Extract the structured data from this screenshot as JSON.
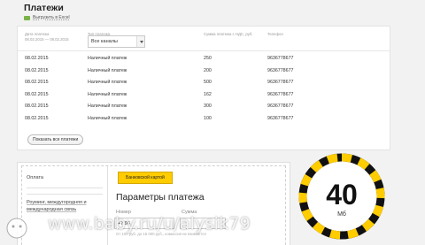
{
  "page": {
    "title": "Платежи",
    "export_label": "Выгрузить в Excel"
  },
  "filters": {
    "date_header": "Дата платежа",
    "date_range": "08.02.2015 — 08.02.2015",
    "type_header": "Тип платежа",
    "channel_selected": "Все каналы",
    "sum_header": "Сумма платежа с НДС, руб.",
    "phone_header": "Телефон"
  },
  "payments": [
    {
      "date": "08.02.2015",
      "type": "Наличный платеж",
      "sum": "250",
      "phone": "9636778677"
    },
    {
      "date": "08.02.2015",
      "type": "Наличный платеж",
      "sum": "200",
      "phone": "9636778677"
    },
    {
      "date": "08.02.2015",
      "type": "Наличный платеж",
      "sum": "500",
      "phone": "9636778677"
    },
    {
      "date": "08.02.2015",
      "type": "Наличный платеж",
      "sum": "162",
      "phone": "9636778677"
    },
    {
      "date": "08.02.2015",
      "type": "Наличный платеж",
      "sum": "300",
      "phone": "9636778677"
    },
    {
      "date": "08.02.2015",
      "type": "Наличный платеж",
      "sum": "100",
      "phone": "9636778677"
    }
  ],
  "show_all_label": "Показать все платежи",
  "payment_panel": {
    "side_active": "Оплата",
    "side_next": "Роуминг, междугородняя и международная связь",
    "badge": "Банковской картой",
    "title": "Параметры платежа",
    "number_label": "Номер",
    "number_value": "+7 96 ",
    "sum_label": "Сумма",
    "hint": "От 100 руб. до 15 000 руб., комиссия не взимается"
  },
  "gauge": {
    "value": "40",
    "unit": "Мб",
    "accent": "#ffcc00"
  },
  "watermark": {
    "text": "www.baby.ru/u/alysik79"
  }
}
